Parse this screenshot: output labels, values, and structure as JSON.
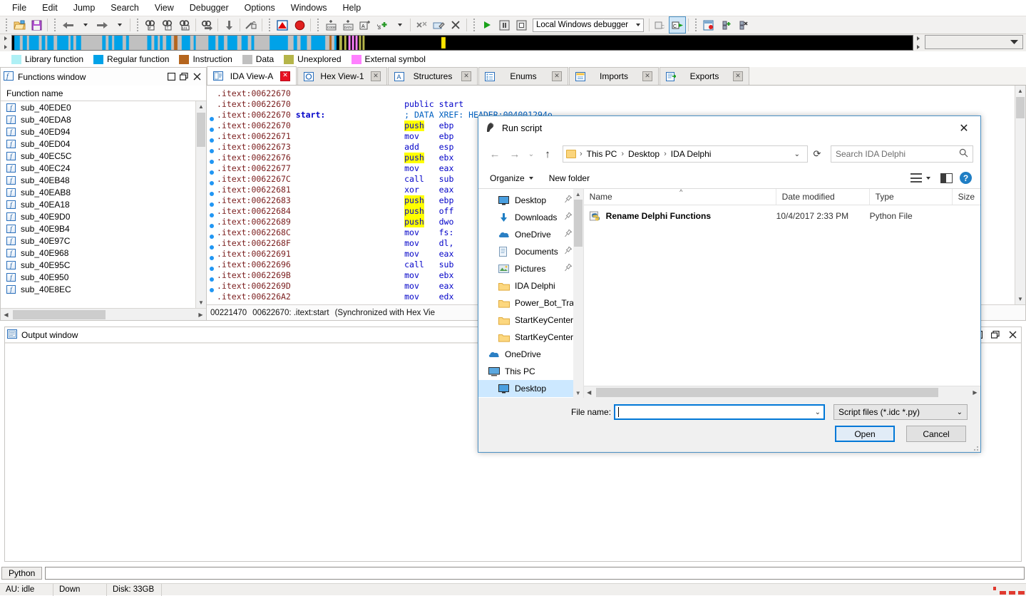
{
  "menubar": [
    "File",
    "Edit",
    "Jump",
    "Search",
    "View",
    "Debugger",
    "Options",
    "Windows",
    "Help"
  ],
  "toolbar": {
    "debugger_select": "Local Windows debugger"
  },
  "legend": [
    {
      "label": "Library function",
      "color": "#aef0f5"
    },
    {
      "label": "Regular function",
      "color": "#00a2e8"
    },
    {
      "label": "Instruction",
      "color": "#b5651d"
    },
    {
      "label": "Data",
      "color": "#c0c0c0"
    },
    {
      "label": "Unexplored",
      "color": "#b5b54a"
    },
    {
      "label": "External symbol",
      "color": "#ff80ff"
    }
  ],
  "functions_window": {
    "title": "Functions window",
    "column_header": "Function name",
    "items": [
      "sub_40E8EC",
      "sub_40E950",
      "sub_40E95C",
      "sub_40E968",
      "sub_40E97C",
      "sub_40E9B4",
      "sub_40E9D0",
      "sub_40EA18",
      "sub_40EAB8",
      "sub_40EB48",
      "sub_40EC24",
      "sub_40EC5C",
      "sub_40ED04",
      "sub_40ED94",
      "sub_40EDA8",
      "sub_40EDE0"
    ]
  },
  "tabs": [
    {
      "label": "IDA View-A",
      "active": true
    },
    {
      "label": "Hex View-1",
      "active": false
    },
    {
      "label": "Structures",
      "active": false
    },
    {
      "label": "Enums",
      "active": false
    },
    {
      "label": "Imports",
      "active": false
    },
    {
      "label": "Exports",
      "active": false
    }
  ],
  "disassembly": {
    "lines": [
      {
        "addr": ".itext:00622670",
        "label": "",
        "mnemonic": "",
        "operand": "",
        "hl": false,
        "bp": false,
        "extra": ""
      },
      {
        "addr": ".itext:00622670",
        "label": "",
        "mnemonic": "",
        "operand": "",
        "hl": false,
        "bp": false,
        "extra": "public start"
      },
      {
        "addr": ".itext:00622670",
        "label": "start:",
        "mnemonic": "",
        "operand": "",
        "hl": false,
        "bp": false,
        "extra": "; DATA XREF: HEADER:004001294o"
      },
      {
        "addr": ".itext:00622670",
        "label": "",
        "mnemonic": "push",
        "operand": "ebp",
        "hl": true,
        "bp": true,
        "extra": ""
      },
      {
        "addr": ".itext:00622671",
        "label": "",
        "mnemonic": "mov",
        "operand": "ebp",
        "hl": false,
        "bp": true,
        "extra": ""
      },
      {
        "addr": ".itext:00622673",
        "label": "",
        "mnemonic": "add",
        "operand": "esp",
        "hl": false,
        "bp": true,
        "extra": ""
      },
      {
        "addr": ".itext:00622676",
        "label": "",
        "mnemonic": "push",
        "operand": "ebx",
        "hl": true,
        "bp": true,
        "extra": ""
      },
      {
        "addr": ".itext:00622677",
        "label": "",
        "mnemonic": "mov",
        "operand": "eax",
        "hl": false,
        "bp": true,
        "extra": ""
      },
      {
        "addr": ".itext:0062267C",
        "label": "",
        "mnemonic": "call",
        "operand": "sub",
        "hl": false,
        "bp": true,
        "extra": ""
      },
      {
        "addr": ".itext:00622681",
        "label": "",
        "mnemonic": "xor",
        "operand": "eax",
        "hl": false,
        "bp": true,
        "extra": ""
      },
      {
        "addr": ".itext:00622683",
        "label": "",
        "mnemonic": "push",
        "operand": "ebp",
        "hl": true,
        "bp": true,
        "extra": ""
      },
      {
        "addr": ".itext:00622684",
        "label": "",
        "mnemonic": "push",
        "operand": "off",
        "hl": true,
        "bp": true,
        "extra": ""
      },
      {
        "addr": ".itext:00622689",
        "label": "",
        "mnemonic": "push",
        "operand": "dwo",
        "hl": true,
        "bp": true,
        "extra": ""
      },
      {
        "addr": ".itext:0062268C",
        "label": "",
        "mnemonic": "mov",
        "operand": "fs:",
        "hl": false,
        "bp": true,
        "extra": ""
      },
      {
        "addr": ".itext:0062268F",
        "label": "",
        "mnemonic": "mov",
        "operand": "dl,",
        "hl": false,
        "bp": true,
        "extra": ""
      },
      {
        "addr": ".itext:00622691",
        "label": "",
        "mnemonic": "mov",
        "operand": "eax",
        "hl": false,
        "bp": true,
        "extra": ""
      },
      {
        "addr": ".itext:00622696",
        "label": "",
        "mnemonic": "call",
        "operand": "sub",
        "hl": false,
        "bp": true,
        "extra": ""
      },
      {
        "addr": ".itext:0062269B",
        "label": "",
        "mnemonic": "mov",
        "operand": "ebx",
        "hl": false,
        "bp": true,
        "extra": ""
      },
      {
        "addr": ".itext:0062269D",
        "label": "",
        "mnemonic": "mov",
        "operand": "eax",
        "hl": false,
        "bp": true,
        "extra": ""
      },
      {
        "addr": ".itext:006226A2",
        "label": "",
        "mnemonic": "mov",
        "operand": "edx",
        "hl": false,
        "bp": true,
        "extra": ""
      }
    ],
    "status": {
      "offset": "00221470",
      "address": "00622670: .itext:start",
      "sync": "(Synchronized with Hex Vie"
    }
  },
  "output_window": {
    "title": "Output window"
  },
  "python_bar": {
    "button": "Python",
    "input_value": ""
  },
  "status_bar": {
    "au": "AU: idle",
    "down": "Down",
    "disk": "Disk: 33GB"
  },
  "dialog": {
    "title": "Run script",
    "close": "✕",
    "breadcrumb": [
      "This PC",
      "Desktop",
      "IDA Delphi"
    ],
    "search_placeholder": "Search IDA Delphi",
    "toolbar": {
      "organize": "Organize",
      "new_folder": "New folder"
    },
    "sidebar": [
      {
        "label": "Desktop",
        "icon": "monitor-icon",
        "pinned": true,
        "indent": true,
        "selected": false
      },
      {
        "label": "Downloads",
        "icon": "download-icon",
        "pinned": true,
        "indent": true,
        "selected": false
      },
      {
        "label": "OneDrive",
        "icon": "cloud-icon",
        "pinned": true,
        "indent": true,
        "selected": false
      },
      {
        "label": "Documents",
        "icon": "document-icon",
        "pinned": true,
        "indent": true,
        "selected": false
      },
      {
        "label": "Pictures",
        "icon": "picture-icon",
        "pinned": true,
        "indent": true,
        "selected": false
      },
      {
        "label": "IDA Delphi",
        "icon": "folder-icon",
        "pinned": false,
        "indent": true,
        "selected": false
      },
      {
        "label": "Power_Bot_Travi",
        "icon": "folder-icon",
        "pinned": false,
        "indent": true,
        "selected": false
      },
      {
        "label": "StartKeyCenter",
        "icon": "folder-icon",
        "pinned": false,
        "indent": true,
        "selected": false
      },
      {
        "label": "StartKeyCenter",
        "icon": "folder-icon",
        "pinned": false,
        "indent": true,
        "selected": false
      },
      {
        "label": "OneDrive",
        "icon": "cloud-icon",
        "pinned": false,
        "indent": false,
        "selected": false
      },
      {
        "label": "This PC",
        "icon": "pc-icon",
        "pinned": false,
        "indent": false,
        "selected": false
      },
      {
        "label": "Desktop",
        "icon": "monitor-icon",
        "pinned": false,
        "indent": true,
        "selected": true
      }
    ],
    "columns": [
      "Name",
      "Date modified",
      "Type",
      "Size"
    ],
    "files": [
      {
        "name": "Rename Delphi Functions",
        "date": "10/4/2017 2:33 PM",
        "type": "Python File",
        "size": ""
      }
    ],
    "filename_label": "File name:",
    "filename_value": "",
    "filter": "Script files (*.idc *.py)",
    "open_button": "Open",
    "cancel_button": "Cancel"
  }
}
